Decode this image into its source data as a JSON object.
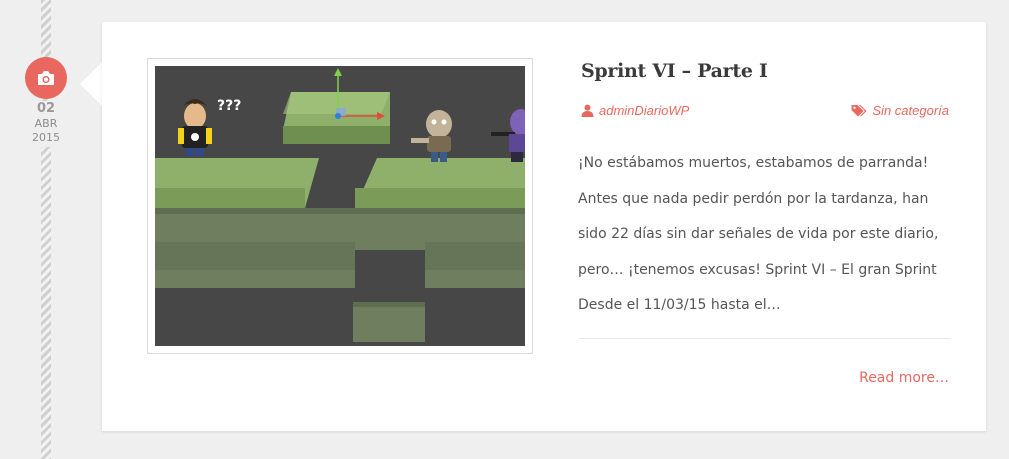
{
  "date": {
    "day": "02",
    "month": "ABR",
    "year": "2015"
  },
  "post": {
    "title": "Sprint VI – Parte I",
    "author": "adminDiarioWP",
    "category": "Sin categoría",
    "excerpt": "¡No estábamos muertos, estabamos de parranda! Antes que nada pedir perdón por la tardanza, han sido 22 días sin dar señales de vida por este diario, pero… ¡tenemos excusas! Sprint VI – El gran Sprint Desde el 11/03/15 hasta el…",
    "read_more": "Read more…",
    "image_caption": "???"
  },
  "icons": {
    "date": "camera-icon",
    "author": "user-icon",
    "category": "tags-icon"
  },
  "colors": {
    "accent": "#e8685f",
    "background": "#efefef",
    "card": "#ffffff",
    "text": "#555555",
    "title": "#3a3a3a"
  }
}
